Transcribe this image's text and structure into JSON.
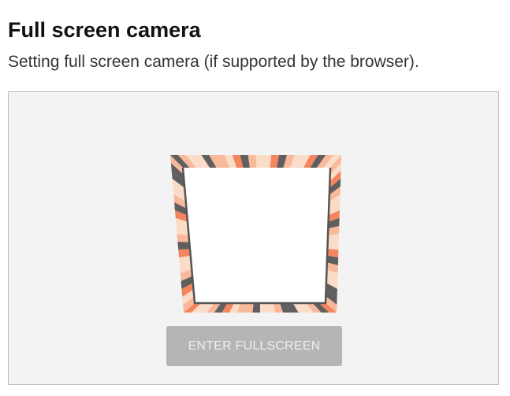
{
  "page": {
    "title": "Full screen camera",
    "subtitle": "Setting full screen camera (if supported by the browser)."
  },
  "viewer": {
    "fullscreen_button_label": "ENTER FULLSCREEN",
    "frame_colors": {
      "dark": "#5f5f5f",
      "orange": "#f4865f",
      "peach": "#f8b89a",
      "cream": "#fbdcc8",
      "background": "#f3f3f3"
    }
  }
}
